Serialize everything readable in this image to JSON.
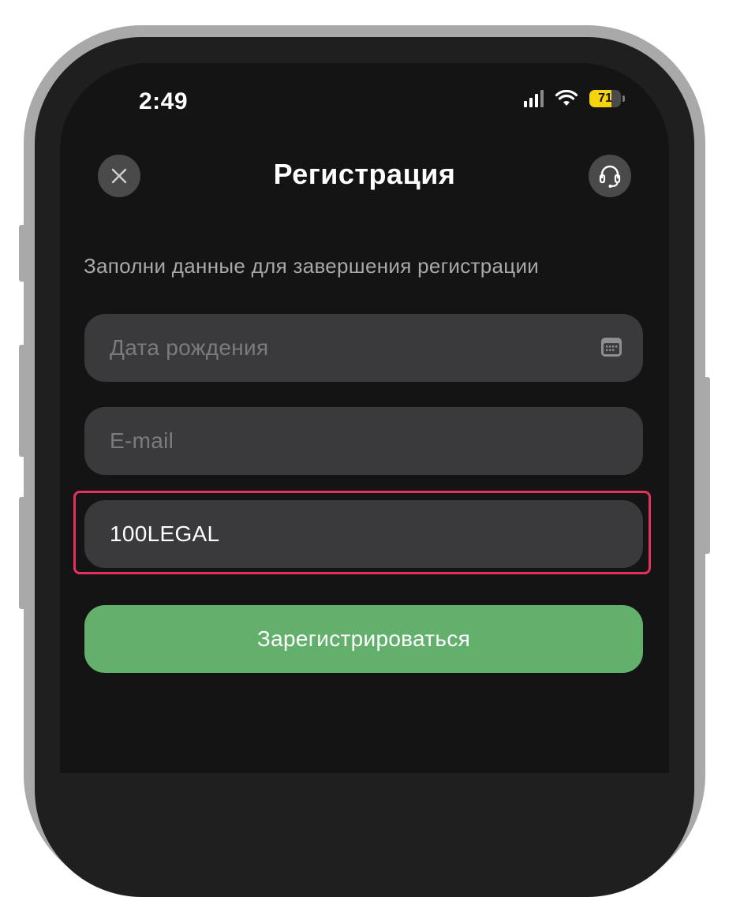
{
  "status_bar": {
    "time": "2:49",
    "battery": "71"
  },
  "header": {
    "title": "Регистрация"
  },
  "subtitle": "Заполни данные для завершения регистрации",
  "fields": {
    "birth_date_placeholder": "Дата рождения",
    "email_placeholder": "E-mail",
    "promo_value": "100LEGAL"
  },
  "register_button_label": "Зарегистрироваться",
  "icons": {
    "close": "close-icon",
    "support": "headset-icon",
    "calendar": "calendar-icon",
    "signal": "signal-icon",
    "wifi": "wifi-icon",
    "battery": "battery-icon"
  },
  "colors": {
    "accent_green": "#63b06c",
    "highlight_pink": "#e8305f",
    "battery_yellow": "#f5d40c",
    "background": "#141414"
  }
}
